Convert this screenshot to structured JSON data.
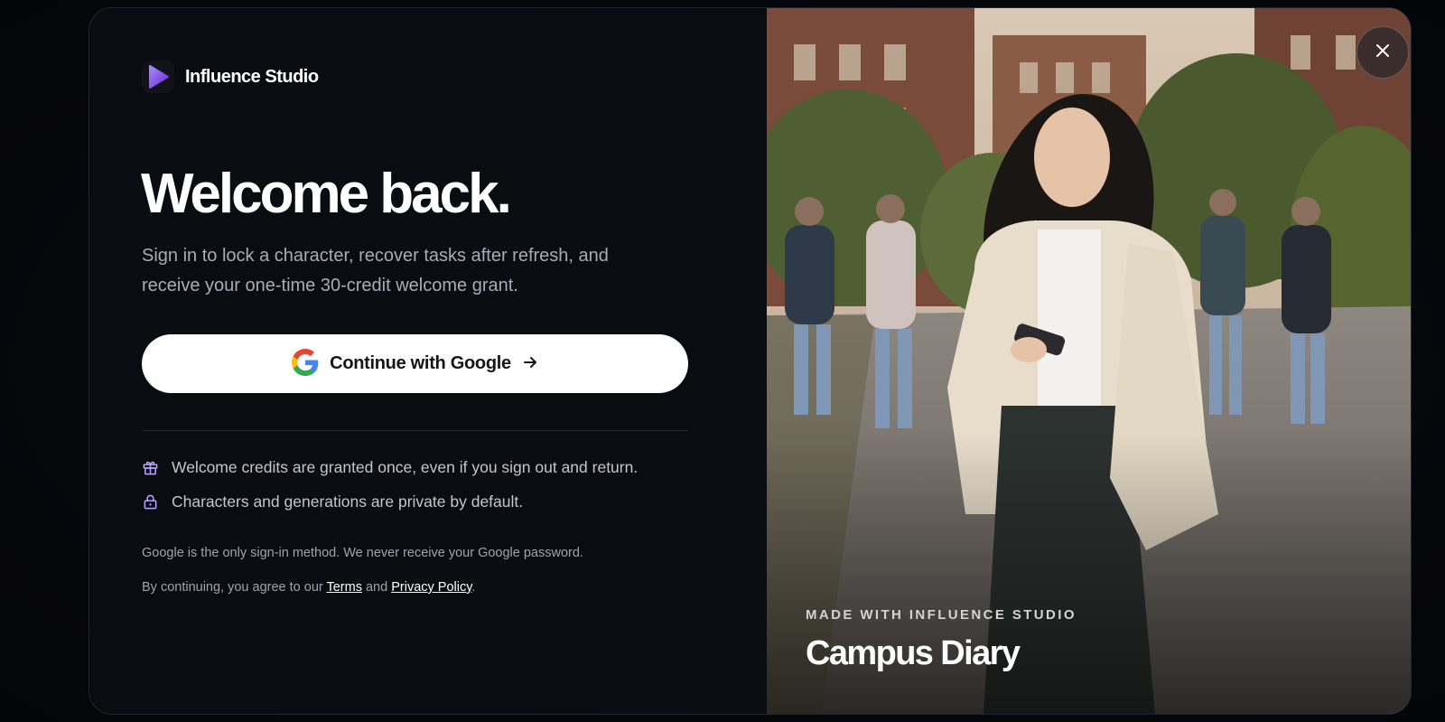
{
  "brand": {
    "name": "Influence Studio",
    "logo_icon": "play-triangle-icon",
    "accent": "#8b5cf6"
  },
  "headline": "Welcome back.",
  "subtitle": "Sign in to lock a character, recover tasks after refresh, and receive your one-time 30-credit welcome grant.",
  "google_button": {
    "label": "Continue with Google",
    "icon": "google-g-icon",
    "trailing_icon": "arrow-right-icon"
  },
  "notes": [
    {
      "icon": "gift-icon",
      "text": "Welcome credits are granted once, even if you sign out and return."
    },
    {
      "icon": "lock-icon",
      "text": "Characters and generations are private by default."
    }
  ],
  "fine_print": {
    "line1": "Google is the only sign-in method. We never receive your Google password.",
    "prefix": "By continuing, you agree to our ",
    "terms": "Terms",
    "and": " and ",
    "privacy": "Privacy Policy",
    "suffix": "."
  },
  "showcase": {
    "kicker": "MADE WITH INFLUENCE STUDIO",
    "title": "Campus Diary",
    "close_icon": "close-icon"
  },
  "colors": {
    "background": "#0b0c11",
    "text_primary": "#ffffff",
    "text_muted": "#a8acb8",
    "button_bg": "#ffffff"
  }
}
